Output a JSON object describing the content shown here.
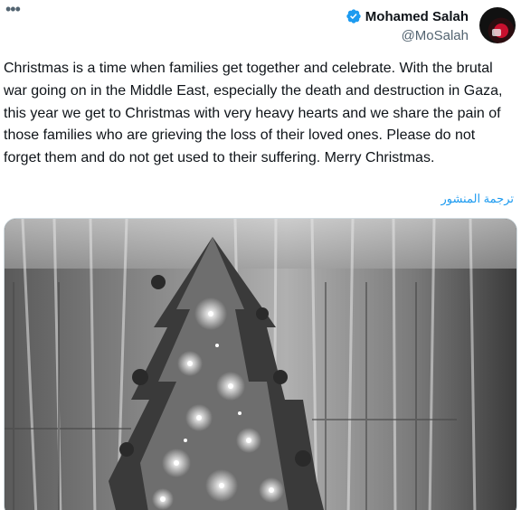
{
  "tweet": {
    "more_label": "•••",
    "author": {
      "display_name": "Mohamed Salah",
      "handle": "@MoSalah",
      "verified_icon": "verified-badge-icon",
      "badge_color": "#1d9bf0"
    },
    "text": "Christmas is a time when families get together and celebrate. With the brutal war going on in the Middle East, especially the death and destruction in Gaza, this year we get to Christmas with very heavy hearts and we share the pain of those families who are grieving the loss of their loved ones. Please do not forget them and do not get used to their suffering. Merry Christmas.",
    "translate_label": "ترجمة المنشور",
    "media": {
      "kind": "black-and-white photo of a lit Christmas tree in front of sheer curtains"
    }
  },
  "colors": {
    "accent": "#1d9bf0",
    "text": "#0f1419",
    "secondary": "#536471"
  }
}
